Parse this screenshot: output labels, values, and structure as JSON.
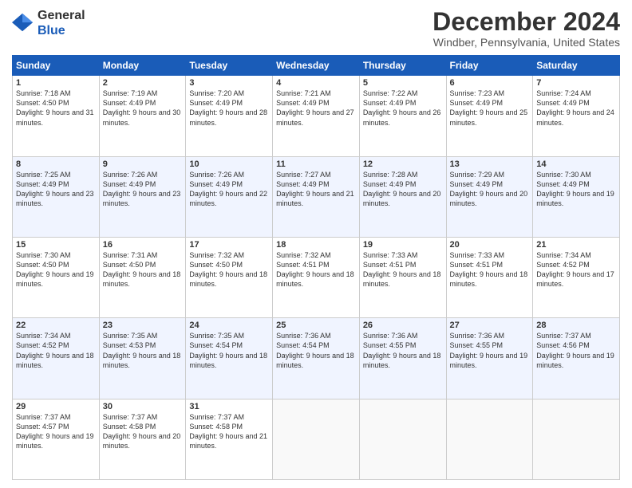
{
  "logo": {
    "text_general": "General",
    "text_blue": "Blue"
  },
  "header": {
    "title": "December 2024",
    "location": "Windber, Pennsylvania, United States"
  },
  "weekdays": [
    "Sunday",
    "Monday",
    "Tuesday",
    "Wednesday",
    "Thursday",
    "Friday",
    "Saturday"
  ],
  "weeks": [
    [
      {
        "day": "1",
        "sunrise": "7:18 AM",
        "sunset": "4:50 PM",
        "daylight": "9 hours and 31 minutes."
      },
      {
        "day": "2",
        "sunrise": "7:19 AM",
        "sunset": "4:49 PM",
        "daylight": "9 hours and 30 minutes."
      },
      {
        "day": "3",
        "sunrise": "7:20 AM",
        "sunset": "4:49 PM",
        "daylight": "9 hours and 28 minutes."
      },
      {
        "day": "4",
        "sunrise": "7:21 AM",
        "sunset": "4:49 PM",
        "daylight": "9 hours and 27 minutes."
      },
      {
        "day": "5",
        "sunrise": "7:22 AM",
        "sunset": "4:49 PM",
        "daylight": "9 hours and 26 minutes."
      },
      {
        "day": "6",
        "sunrise": "7:23 AM",
        "sunset": "4:49 PM",
        "daylight": "9 hours and 25 minutes."
      },
      {
        "day": "7",
        "sunrise": "7:24 AM",
        "sunset": "4:49 PM",
        "daylight": "9 hours and 24 minutes."
      }
    ],
    [
      {
        "day": "8",
        "sunrise": "7:25 AM",
        "sunset": "4:49 PM",
        "daylight": "9 hours and 23 minutes."
      },
      {
        "day": "9",
        "sunrise": "7:26 AM",
        "sunset": "4:49 PM",
        "daylight": "9 hours and 23 minutes."
      },
      {
        "day": "10",
        "sunrise": "7:26 AM",
        "sunset": "4:49 PM",
        "daylight": "9 hours and 22 minutes."
      },
      {
        "day": "11",
        "sunrise": "7:27 AM",
        "sunset": "4:49 PM",
        "daylight": "9 hours and 21 minutes."
      },
      {
        "day": "12",
        "sunrise": "7:28 AM",
        "sunset": "4:49 PM",
        "daylight": "9 hours and 20 minutes."
      },
      {
        "day": "13",
        "sunrise": "7:29 AM",
        "sunset": "4:49 PM",
        "daylight": "9 hours and 20 minutes."
      },
      {
        "day": "14",
        "sunrise": "7:30 AM",
        "sunset": "4:49 PM",
        "daylight": "9 hours and 19 minutes."
      }
    ],
    [
      {
        "day": "15",
        "sunrise": "7:30 AM",
        "sunset": "4:50 PM",
        "daylight": "9 hours and 19 minutes."
      },
      {
        "day": "16",
        "sunrise": "7:31 AM",
        "sunset": "4:50 PM",
        "daylight": "9 hours and 18 minutes."
      },
      {
        "day": "17",
        "sunrise": "7:32 AM",
        "sunset": "4:50 PM",
        "daylight": "9 hours and 18 minutes."
      },
      {
        "day": "18",
        "sunrise": "7:32 AM",
        "sunset": "4:51 PM",
        "daylight": "9 hours and 18 minutes."
      },
      {
        "day": "19",
        "sunrise": "7:33 AM",
        "sunset": "4:51 PM",
        "daylight": "9 hours and 18 minutes."
      },
      {
        "day": "20",
        "sunrise": "7:33 AM",
        "sunset": "4:51 PM",
        "daylight": "9 hours and 18 minutes."
      },
      {
        "day": "21",
        "sunrise": "7:34 AM",
        "sunset": "4:52 PM",
        "daylight": "9 hours and 17 minutes."
      }
    ],
    [
      {
        "day": "22",
        "sunrise": "7:34 AM",
        "sunset": "4:52 PM",
        "daylight": "9 hours and 18 minutes."
      },
      {
        "day": "23",
        "sunrise": "7:35 AM",
        "sunset": "4:53 PM",
        "daylight": "9 hours and 18 minutes."
      },
      {
        "day": "24",
        "sunrise": "7:35 AM",
        "sunset": "4:54 PM",
        "daylight": "9 hours and 18 minutes."
      },
      {
        "day": "25",
        "sunrise": "7:36 AM",
        "sunset": "4:54 PM",
        "daylight": "9 hours and 18 minutes."
      },
      {
        "day": "26",
        "sunrise": "7:36 AM",
        "sunset": "4:55 PM",
        "daylight": "9 hours and 18 minutes."
      },
      {
        "day": "27",
        "sunrise": "7:36 AM",
        "sunset": "4:55 PM",
        "daylight": "9 hours and 19 minutes."
      },
      {
        "day": "28",
        "sunrise": "7:37 AM",
        "sunset": "4:56 PM",
        "daylight": "9 hours and 19 minutes."
      }
    ],
    [
      {
        "day": "29",
        "sunrise": "7:37 AM",
        "sunset": "4:57 PM",
        "daylight": "9 hours and 19 minutes."
      },
      {
        "day": "30",
        "sunrise": "7:37 AM",
        "sunset": "4:58 PM",
        "daylight": "9 hours and 20 minutes."
      },
      {
        "day": "31",
        "sunrise": "7:37 AM",
        "sunset": "4:58 PM",
        "daylight": "9 hours and 21 minutes."
      },
      null,
      null,
      null,
      null
    ]
  ]
}
